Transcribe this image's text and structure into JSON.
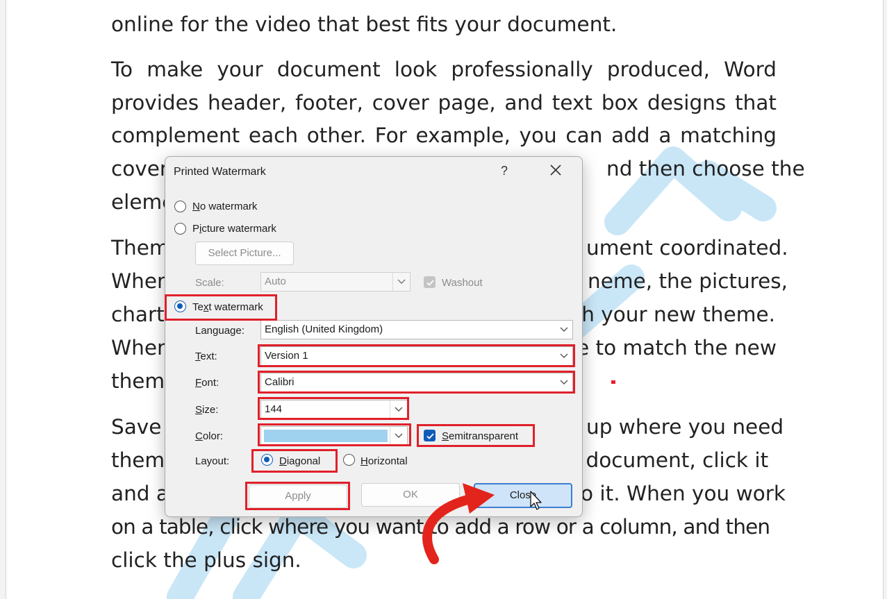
{
  "document": {
    "paragraphs": [
      "online for the video that best fits your document.",
      "To make your document look professionally produced, Word provides header, footer, cover page, and text box designs that complement each other. For example, you can add a matching cover",
      "nd then choose the",
      "eleme",
      "Them",
      "ument coordinated.",
      "When",
      "neme, the pictures,",
      "chart",
      "ch your new theme.",
      "When",
      "e to match the new",
      "them",
      "Save",
      "up where you need",
      "them",
      "r document, click it",
      "and a",
      "o it. When you work",
      "on a table, click where you want to add a row or a column, and then",
      "click the plus sign."
    ]
  },
  "dialog": {
    "title": "Printed Watermark",
    "help": "?",
    "no_watermark": "No watermark",
    "picture_watermark": "Picture watermark",
    "select_picture": "Select Picture...",
    "scale_label": "Scale:",
    "scale_value": "Auto",
    "washout": "Washout",
    "text_watermark": "Text watermark",
    "language_label": "Language:",
    "language_value": "English (United Kingdom)",
    "text_label": "Text:",
    "text_value": "Version 1",
    "font_label": "Font:",
    "font_value": "Calibri",
    "size_label": "Size:",
    "size_value": "144",
    "color_label": "Color:",
    "color_value": "#9fd2ef",
    "semitransparent": "Semitransparent",
    "layout_label": "Layout:",
    "diagonal": "Diagonal",
    "horizontal": "Horizontal",
    "apply": "Apply",
    "ok": "OK",
    "close": "Close"
  },
  "colors": {
    "highlight": "#e0202a",
    "accent": "#0f5cb8",
    "watermark": "#b9dff6"
  }
}
